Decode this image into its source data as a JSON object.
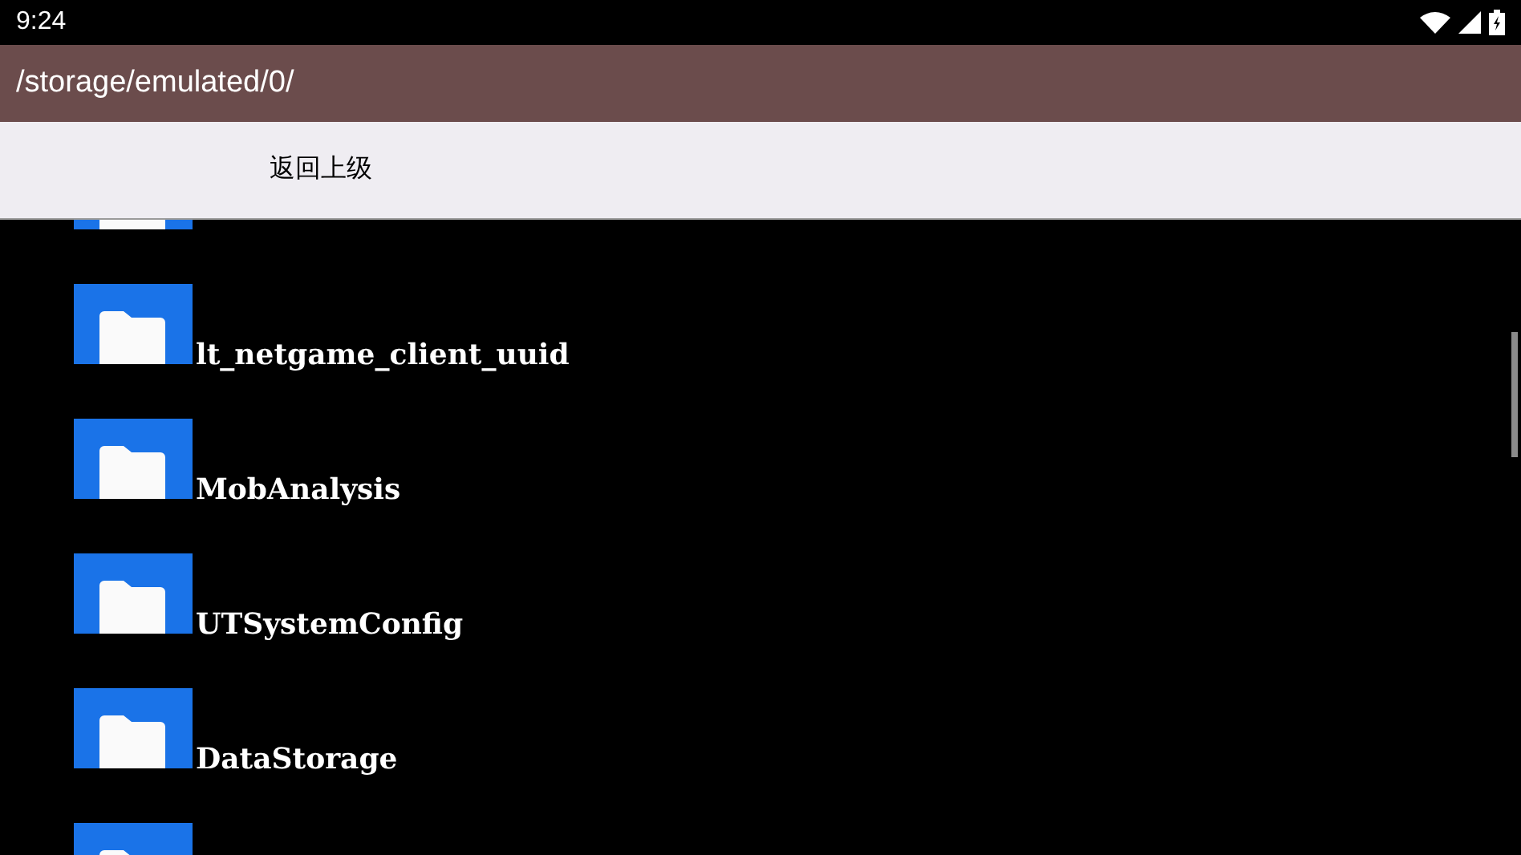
{
  "status_bar": {
    "time": "9:24"
  },
  "path_bar": {
    "path": "/storage/emulated/0/"
  },
  "toolbar": {
    "up_button": "返回上级"
  },
  "files": [
    {
      "kind": "folder"
    },
    {
      "kind": "folder",
      "name": "lt_netgame_client_uuid"
    },
    {
      "kind": "folder",
      "name": "MobAnalysis"
    },
    {
      "kind": "folder",
      "name": "UTSystemConfig"
    },
    {
      "kind": "folder",
      "name": "DataStorage"
    },
    {
      "kind": "folder"
    }
  ]
}
